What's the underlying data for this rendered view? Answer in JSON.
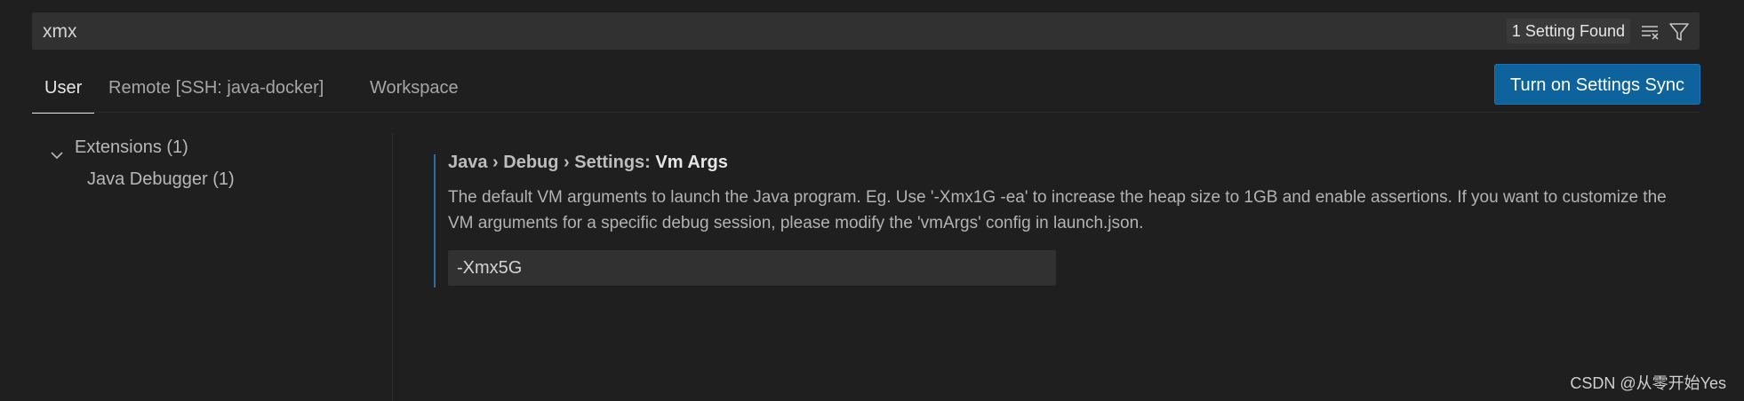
{
  "search": {
    "value": "xmx",
    "results_label": "1 Setting Found",
    "clear_icon": "clear-filter-icon",
    "filter_icon": "filter-icon"
  },
  "tabs": [
    {
      "label": "User",
      "active": true
    },
    {
      "label": "Remote [SSH: java-docker]",
      "active": false
    },
    {
      "label": "Workspace",
      "active": false
    }
  ],
  "sync_button": {
    "label": "Turn on Settings Sync"
  },
  "toc": {
    "items": [
      {
        "label": "Extensions (1)",
        "expanded": true,
        "icon": "chevron-down-icon"
      },
      {
        "label": "Java Debugger (1)"
      }
    ]
  },
  "setting": {
    "category": "Java › Debug › Settings: ",
    "name": "Vm Args",
    "description": "The default VM arguments to launch the Java program. Eg. Use '-Xmx1G -ea' to increase the heap size to 1GB and enable assertions. If you want to customize the VM arguments for a specific debug session, please modify the 'vmArgs' config in launch.json.",
    "value": "-Xmx5G"
  },
  "watermark": "CSDN @从零开始Yes",
  "colors": {
    "background": "#1f1f1f",
    "accent_button": "#0e639c",
    "focus_bar": "#2a6ea6"
  }
}
